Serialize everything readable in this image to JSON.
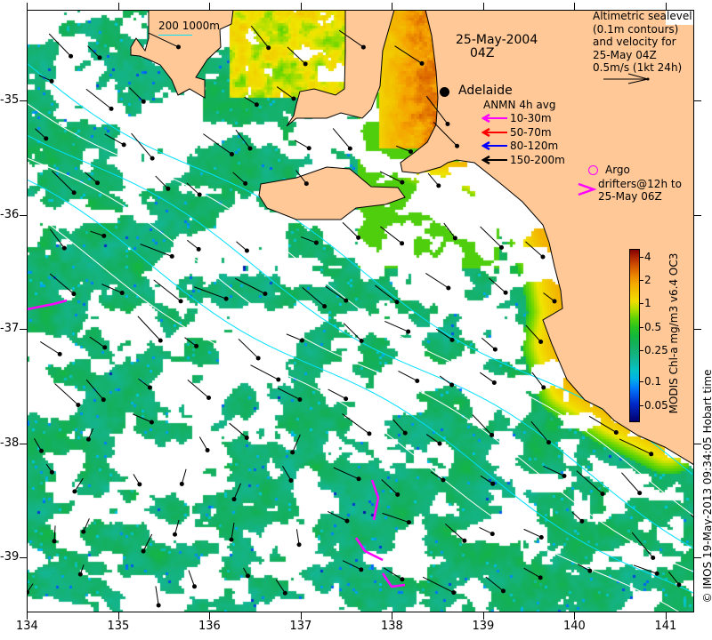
{
  "map": {
    "date": "25-May-2004",
    "time": "04Z",
    "scale_bar": "200  1000m",
    "city": "Adelaide",
    "altimetry_legend": [
      "Altimetric sealevel",
      "(0.1m contours)",
      "and velocity for",
      "25-May 04Z",
      "0.5m/s (1kt 24h)"
    ],
    "anmn": {
      "title": "ANMN 4h avg",
      "items": [
        {
          "label": "10-30m",
          "color": "#ff00ff"
        },
        {
          "label": "50-70m",
          "color": "#ff0000"
        },
        {
          "label": "80-120m",
          "color": "#0000ff"
        },
        {
          "label": "150-200m",
          "color": "#000000"
        }
      ]
    },
    "argo_label": "Argo",
    "drifters_label": [
      "drifters@12h to",
      "25-May 06Z"
    ],
    "colors": {
      "land": "#ffc896",
      "contour": "#00e0ff",
      "argo": "#ff00ff",
      "coast": "#000000"
    }
  },
  "axes": {
    "lon_ticks": [
      "134",
      "135",
      "136",
      "137",
      "138",
      "139",
      "140",
      "141"
    ],
    "lat_ticks": [
      "-35",
      "-36",
      "-37",
      "-38",
      "-39"
    ],
    "lon_range": [
      134,
      141.32
    ],
    "lat_range": [
      -39.48,
      -34.21
    ]
  },
  "colorbar": {
    "label": "MODIS Chl-a mg/m3 v6.4 OC3",
    "ticks": [
      "4",
      "2",
      "1",
      "0.5",
      "0.25",
      "0.1",
      "0.05"
    ],
    "scale": "log"
  },
  "credit": "© IMOS 19-May-2013 09:34:05 Hobart time"
}
